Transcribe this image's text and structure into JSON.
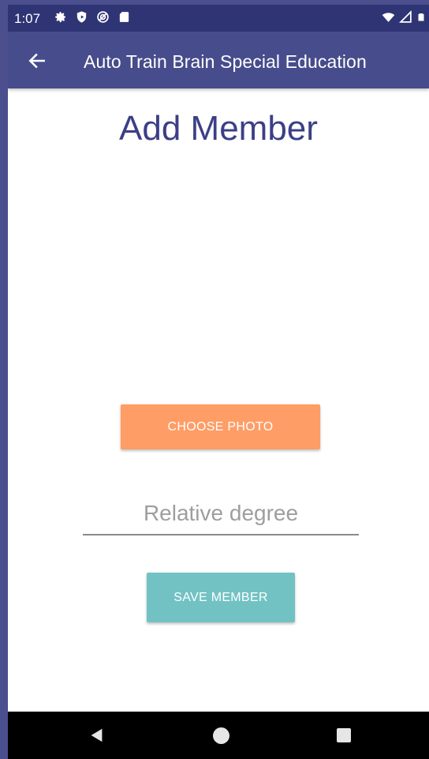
{
  "status_bar": {
    "time": "1:07",
    "left_icons": [
      "settings-icon",
      "shield-icon",
      "vpn-icon",
      "sd-card-icon"
    ],
    "right_icons": [
      "wifi-icon",
      "signal-icon",
      "battery-icon"
    ]
  },
  "app_bar": {
    "back_icon": "arrow-back-icon",
    "title": "Auto Train Brain Special Education"
  },
  "main": {
    "page_title": "Add Member",
    "choose_photo_label": "CHOOSE PHOTO",
    "relative_degree": {
      "value": "",
      "placeholder": "Relative degree"
    },
    "save_member_label": "SAVE MEMBER"
  },
  "nav_bar": {
    "icons": [
      "nav-back-icon",
      "nav-home-icon",
      "nav-recents-icon"
    ]
  },
  "colors": {
    "status_bar": "#2f3475",
    "app_bar": "#474c8c",
    "title_text": "#3c3f86",
    "choose_photo_button": "#ff9d66",
    "save_member_button": "#72c2c4"
  }
}
